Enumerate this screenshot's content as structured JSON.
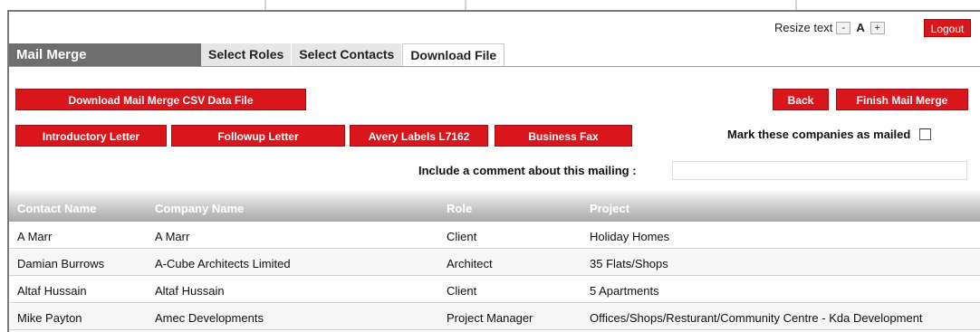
{
  "header": {
    "resize_label": "Resize text",
    "resize_minus": "-",
    "resize_a": "A",
    "resize_plus": "+",
    "logout_label": "Logout"
  },
  "title": "Mail Merge",
  "tabs": [
    {
      "label": "Select Roles",
      "active": false
    },
    {
      "label": "Select Contacts",
      "active": false
    },
    {
      "label": "Download File",
      "active": true
    }
  ],
  "actions": {
    "download_csv": "Download Mail Merge CSV Data File",
    "back": "Back",
    "finish": "Finish Mail Merge",
    "introductory_letter": "Introductory Letter",
    "followup_letter": "Followup Letter",
    "avery_labels": "Avery Labels L7162",
    "business_fax": "Business Fax"
  },
  "mark_mailed": {
    "label": "Mark these companies as mailed",
    "checked": false
  },
  "comment": {
    "label": "Include a comment about this mailing :",
    "value": ""
  },
  "table": {
    "columns": [
      "Contact Name",
      "Company Name",
      "Role",
      "Project"
    ],
    "rows": [
      [
        "A Marr",
        "A Marr",
        "Client",
        "Holiday Homes"
      ],
      [
        "Damian Burrows",
        "A-Cube Architects Limited",
        "Architect",
        "35 Flats/Shops"
      ],
      [
        "Altaf Hussain",
        "Altaf Hussain",
        "Client",
        "5 Apartments"
      ],
      [
        "Mike Payton",
        "Amec Developments",
        "Project Manager",
        "Offices/Shops/Resturant/Community Centre - Kda Development"
      ]
    ]
  },
  "colors": {
    "accent_red": "#d8161b",
    "title_bar": "#6e6e6e"
  }
}
